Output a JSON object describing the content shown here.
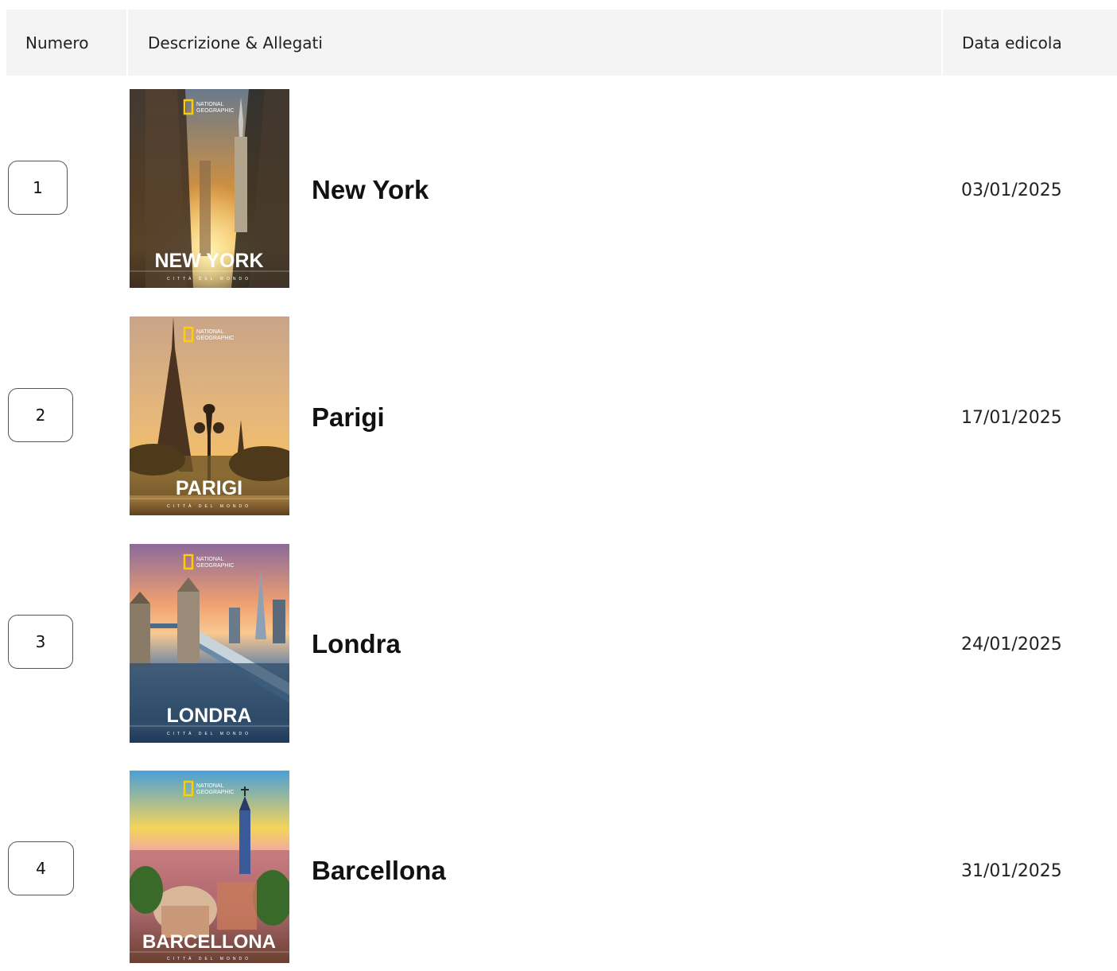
{
  "header": {
    "col_number": "Numero",
    "col_description": "Descrizione & Allegati",
    "col_date": "Data edicola"
  },
  "cover_common": {
    "brand_line1": "NATIONAL",
    "brand_line2": "GEOGRAPHIC",
    "series_caption": "CITTÀ DEL MONDO"
  },
  "issues": [
    {
      "number": "1",
      "title": "New York",
      "cover_title": "NEW YORK",
      "date": "03/01/2025"
    },
    {
      "number": "2",
      "title": "Parigi",
      "cover_title": "PARIGI",
      "date": "17/01/2025"
    },
    {
      "number": "3",
      "title": "Londra",
      "cover_title": "LONDRA",
      "date": "24/01/2025"
    },
    {
      "number": "4",
      "title": "Barcellona",
      "cover_title": "BARCELLONA",
      "date": "31/01/2025"
    }
  ],
  "colors": {
    "header_bg": "#f4f4f4",
    "brand_yellow": "#ffce00"
  }
}
